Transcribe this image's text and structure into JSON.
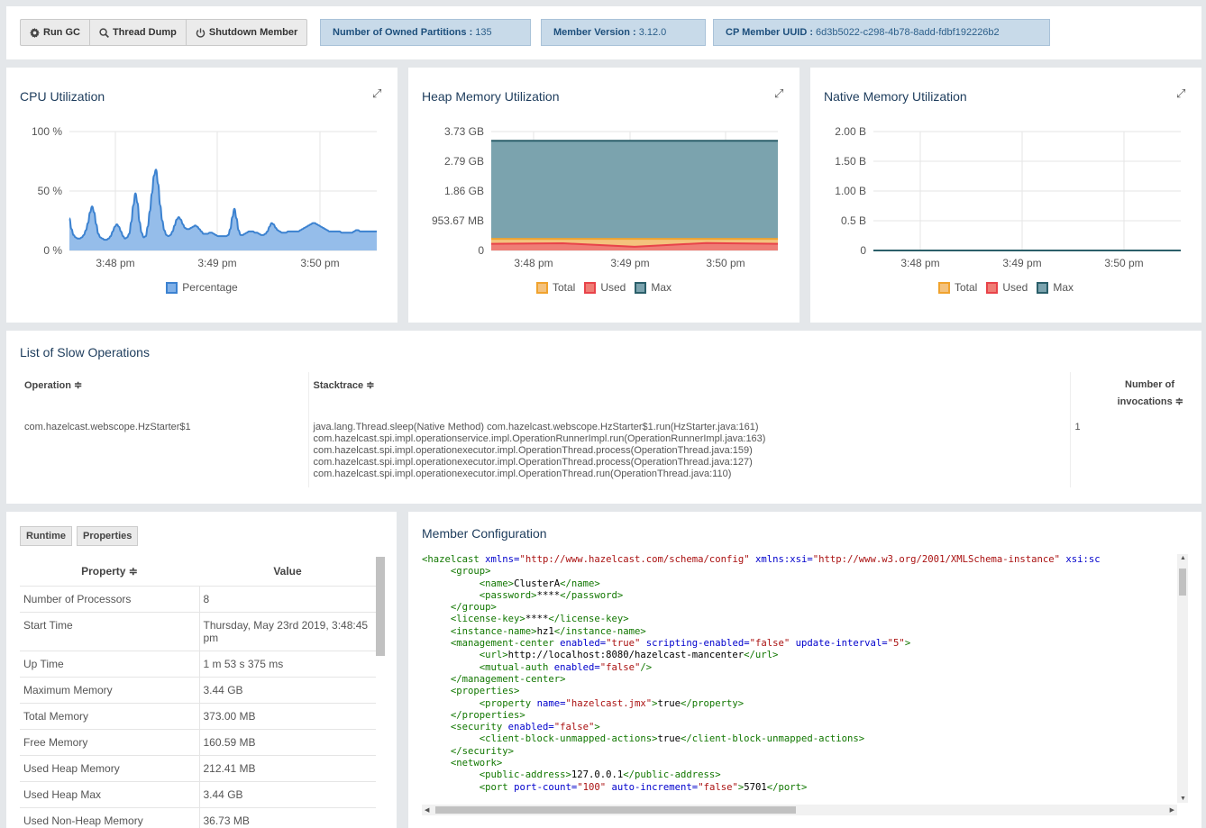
{
  "toolbar": {
    "run_gc": "Run GC",
    "thread_dump": "Thread Dump",
    "shutdown_member": "Shutdown Member",
    "partitions_label": "Number of Owned Partitions :",
    "partitions_value": "135",
    "version_label": "Member Version :",
    "version_value": "3.12.0",
    "uuid_label": "CP Member UUID :",
    "uuid_value": "6d3b5022-c298-4b78-8add-fdbf192226b2"
  },
  "cpu": {
    "title": "CPU Utilization"
  },
  "heap": {
    "title": "Heap Memory Utilization"
  },
  "native": {
    "title": "Native Memory Utilization"
  },
  "chart_data": [
    {
      "type": "area",
      "title": "CPU Utilization",
      "x_ticks": [
        "3:48 pm",
        "3:49 pm",
        "3:50 pm"
      ],
      "y_ticks": [
        "100 %",
        "50 %",
        "0 %"
      ],
      "ylim": [
        0,
        100
      ],
      "grid": true,
      "legend_position": "bottom",
      "series": [
        {
          "name": "Percentage",
          "color": "#3c82d0",
          "fill": "#95bdea",
          "x": [
            0,
            1,
            2,
            3,
            4,
            5,
            6,
            7,
            8,
            9,
            10,
            11,
            12,
            13,
            14,
            15,
            16,
            17,
            18,
            19,
            20,
            21,
            22,
            23,
            24,
            25,
            26,
            27,
            28,
            29,
            30,
            31,
            32,
            33,
            34,
            35,
            36,
            37,
            38,
            39,
            40,
            41,
            42,
            43,
            44,
            45,
            46,
            47,
            48,
            49,
            50,
            51,
            52,
            53,
            54,
            55,
            56,
            57,
            58,
            59,
            60,
            61,
            62,
            63,
            64,
            65,
            66,
            67,
            68,
            69,
            70,
            71,
            72,
            73,
            74,
            75,
            76,
            77,
            78,
            79,
            80,
            81,
            82,
            83,
            84,
            85,
            86,
            87,
            88,
            89,
            90,
            91,
            92,
            93,
            94,
            95,
            96,
            97,
            98,
            99,
            100,
            101,
            102,
            103,
            104,
            105,
            106,
            107,
            108,
            109,
            110,
            111,
            112,
            113,
            114,
            115,
            116,
            117,
            118,
            119,
            120,
            121,
            122,
            123,
            124,
            125,
            126,
            127,
            128,
            129,
            130,
            131,
            132,
            133,
            134,
            135,
            136,
            137,
            138,
            139,
            140,
            141,
            142,
            143,
            144,
            145,
            146,
            147,
            148,
            149
          ],
          "values": [
            27,
            18,
            13,
            11,
            10,
            10,
            11,
            13,
            17,
            23,
            32,
            37,
            32,
            22,
            14,
            11,
            10,
            9,
            9,
            10,
            12,
            16,
            20,
            22,
            20,
            16,
            12,
            10,
            11,
            14,
            24,
            38,
            48,
            40,
            24,
            15,
            11,
            12,
            20,
            33,
            48,
            63,
            68,
            56,
            38,
            25,
            17,
            13,
            12,
            13,
            16,
            21,
            26,
            28,
            26,
            22,
            19,
            18,
            18,
            19,
            20,
            21,
            20,
            18,
            16,
            14,
            14,
            14,
            15,
            15,
            14,
            13,
            12,
            12,
            12,
            12,
            12,
            13,
            18,
            28,
            35,
            27,
            17,
            13,
            13,
            14,
            15,
            16,
            16,
            16,
            15,
            15,
            14,
            13,
            13,
            14,
            16,
            20,
            23,
            22,
            19,
            17,
            16,
            15,
            15,
            15,
            16,
            16,
            16,
            16,
            16,
            16,
            17,
            18,
            19,
            20,
            21,
            22,
            23,
            23,
            22,
            21,
            20,
            19,
            18,
            17,
            16,
            16,
            16,
            16,
            16,
            16,
            15,
            15,
            15,
            15,
            15,
            15,
            16,
            17,
            17,
            16,
            16,
            16,
            16,
            16,
            16,
            16,
            16,
            16
          ]
        }
      ]
    },
    {
      "type": "area",
      "title": "Heap Memory Utilization",
      "x_ticks": [
        "3:48 pm",
        "3:49 pm",
        "3:50 pm"
      ],
      "y_ticks": [
        "3.73 GB",
        "2.79 GB",
        "1.86 GB",
        "953.67 MB",
        "0"
      ],
      "ylim_gb": [
        0,
        3.73
      ],
      "grid": true,
      "legend_position": "bottom",
      "series": [
        {
          "name": "Total",
          "color": "#f0a32e",
          "fill": "#f4c27d",
          "values_mb": [
            373,
            373,
            373,
            373,
            373
          ]
        },
        {
          "name": "Used",
          "color": "#e8434a",
          "fill": "#ef7d75",
          "values_mb": [
            212,
            230,
            120,
            240,
            212
          ]
        },
        {
          "name": "Max",
          "color": "#2b5f6a",
          "fill": "#7ba3ae",
          "values_gb": [
            3.44,
            3.44,
            3.44,
            3.44,
            3.44
          ]
        }
      ]
    },
    {
      "type": "line",
      "title": "Native Memory Utilization",
      "x_ticks": [
        "3:48 pm",
        "3:49 pm",
        "3:50 pm"
      ],
      "y_ticks": [
        "2.00 B",
        "1.50 B",
        "1.00 B",
        "0.5 B",
        "0"
      ],
      "ylim": [
        0,
        2
      ],
      "grid": true,
      "legend_position": "bottom",
      "series": [
        {
          "name": "Total",
          "color": "#f0a32e",
          "fill": "#f4c27d",
          "values": [
            0,
            0,
            0,
            0,
            0
          ]
        },
        {
          "name": "Used",
          "color": "#e8434a",
          "fill": "#ef7d75",
          "values": [
            0,
            0,
            0,
            0,
            0
          ]
        },
        {
          "name": "Max",
          "color": "#2b5f6a",
          "fill": "#7ba3ae",
          "values": [
            0,
            0,
            0,
            0,
            0
          ]
        }
      ]
    }
  ],
  "slow_ops": {
    "title": "List of Slow Operations",
    "headers": {
      "operation": "Operation ≑",
      "stacktrace": "Stacktrace ≑",
      "invocations_1": "Number of",
      "invocations_2": "invocations ≑"
    },
    "rows": [
      {
        "operation": "com.hazelcast.webscope.HzStarter$1",
        "stack": [
          "java.lang.Thread.sleep(Native Method) com.hazelcast.webscope.HzStarter$1.run(HzStarter.java:161)",
          "com.hazelcast.spi.impl.operationservice.impl.OperationRunnerImpl.run(OperationRunnerImpl.java:163)",
          "com.hazelcast.spi.impl.operationexecutor.impl.OperationThread.process(OperationThread.java:159)",
          "com.hazelcast.spi.impl.operationexecutor.impl.OperationThread.process(OperationThread.java:127)",
          "com.hazelcast.spi.impl.operationexecutor.impl.OperationThread.run(OperationThread.java:110)"
        ],
        "invocations": "1"
      }
    ]
  },
  "props": {
    "tab_runtime": "Runtime",
    "tab_properties": "Properties",
    "col_property": "Property ≑",
    "col_value": "Value",
    "rows": [
      {
        "k": "Number of Processors",
        "v": "8"
      },
      {
        "k": "Start Time",
        "v": "Thursday, May 23rd 2019, 3:48:45 pm"
      },
      {
        "k": "Up Time",
        "v": "1 m 53 s 375 ms"
      },
      {
        "k": "Maximum Memory",
        "v": "3.44 GB"
      },
      {
        "k": "Total Memory",
        "v": "373.00 MB"
      },
      {
        "k": "Free Memory",
        "v": "160.59 MB"
      },
      {
        "k": "Used Heap Memory",
        "v": "212.41 MB"
      },
      {
        "k": "Used Heap Max",
        "v": "3.44 GB"
      },
      {
        "k": "Used Non-Heap Memory",
        "v": "36.73 MB"
      }
    ]
  },
  "config": {
    "title": "Member Configuration",
    "lines": [
      [
        [
          "tg",
          "<hazelcast "
        ],
        [
          "at",
          "xmlns="
        ],
        [
          "vl",
          "\"http://www.hazelcast.com/schema/config\""
        ],
        [
          "at",
          " xmlns:xsi="
        ],
        [
          "vl",
          "\"http://www.w3.org/2001/XMLSchema-instance\""
        ],
        [
          "at",
          " xsi:sc"
        ]
      ],
      [
        [
          "tx",
          "     "
        ],
        [
          "tg",
          "<group>"
        ]
      ],
      [
        [
          "tx",
          "          "
        ],
        [
          "tg",
          "<name>"
        ],
        [
          "tx",
          "ClusterA"
        ],
        [
          "tg",
          "</name>"
        ]
      ],
      [
        [
          "tx",
          "          "
        ],
        [
          "tg",
          "<password>"
        ],
        [
          "tx",
          "****"
        ],
        [
          "tg",
          "</password>"
        ]
      ],
      [
        [
          "tx",
          "     "
        ],
        [
          "tg",
          "</group>"
        ]
      ],
      [
        [
          "tx",
          "     "
        ],
        [
          "tg",
          "<license-key>"
        ],
        [
          "tx",
          "****"
        ],
        [
          "tg",
          "</license-key>"
        ]
      ],
      [
        [
          "tx",
          "     "
        ],
        [
          "tg",
          "<instance-name>"
        ],
        [
          "tx",
          "hz1"
        ],
        [
          "tg",
          "</instance-name>"
        ]
      ],
      [
        [
          "tx",
          "     "
        ],
        [
          "tg",
          "<management-center "
        ],
        [
          "at",
          "enabled="
        ],
        [
          "vl",
          "\"true\""
        ],
        [
          "at",
          " scripting-enabled="
        ],
        [
          "vl",
          "\"false\""
        ],
        [
          "at",
          " update-interval="
        ],
        [
          "vl",
          "\"5\""
        ],
        [
          "tg",
          ">"
        ]
      ],
      [
        [
          "tx",
          "          "
        ],
        [
          "tg",
          "<url>"
        ],
        [
          "tx",
          "http://localhost:8080/hazelcast-mancenter"
        ],
        [
          "tg",
          "</url>"
        ]
      ],
      [
        [
          "tx",
          "          "
        ],
        [
          "tg",
          "<mutual-auth "
        ],
        [
          "at",
          "enabled="
        ],
        [
          "vl",
          "\"false\""
        ],
        [
          "tg",
          "/>"
        ]
      ],
      [
        [
          "tx",
          "     "
        ],
        [
          "tg",
          "</management-center>"
        ]
      ],
      [
        [
          "tx",
          "     "
        ],
        [
          "tg",
          "<properties>"
        ]
      ],
      [
        [
          "tx",
          "          "
        ],
        [
          "tg",
          "<property "
        ],
        [
          "at",
          "name="
        ],
        [
          "vl",
          "\"hazelcast.jmx\""
        ],
        [
          "tg",
          ">"
        ],
        [
          "tx",
          "true"
        ],
        [
          "tg",
          "</property>"
        ]
      ],
      [
        [
          "tx",
          "     "
        ],
        [
          "tg",
          "</properties>"
        ]
      ],
      [
        [
          "tx",
          "     "
        ],
        [
          "tg",
          "<security "
        ],
        [
          "at",
          "enabled="
        ],
        [
          "vl",
          "\"false\""
        ],
        [
          "tg",
          ">"
        ]
      ],
      [
        [
          "tx",
          "          "
        ],
        [
          "tg",
          "<client-block-unmapped-actions>"
        ],
        [
          "tx",
          "true"
        ],
        [
          "tg",
          "</client-block-unmapped-actions>"
        ]
      ],
      [
        [
          "tx",
          "     "
        ],
        [
          "tg",
          "</security>"
        ]
      ],
      [
        [
          "tx",
          "     "
        ],
        [
          "tg",
          "<network>"
        ]
      ],
      [
        [
          "tx",
          "          "
        ],
        [
          "tg",
          "<public-address>"
        ],
        [
          "tx",
          "127.0.0.1"
        ],
        [
          "tg",
          "</public-address>"
        ]
      ],
      [
        [
          "tx",
          "          "
        ],
        [
          "tg",
          "<port "
        ],
        [
          "at",
          "port-count="
        ],
        [
          "vl",
          "\"100\""
        ],
        [
          "at",
          " auto-increment="
        ],
        [
          "vl",
          "\"false\""
        ],
        [
          "tg",
          ">"
        ],
        [
          "tx",
          "5701"
        ],
        [
          "tg",
          "</port>"
        ]
      ]
    ]
  }
}
